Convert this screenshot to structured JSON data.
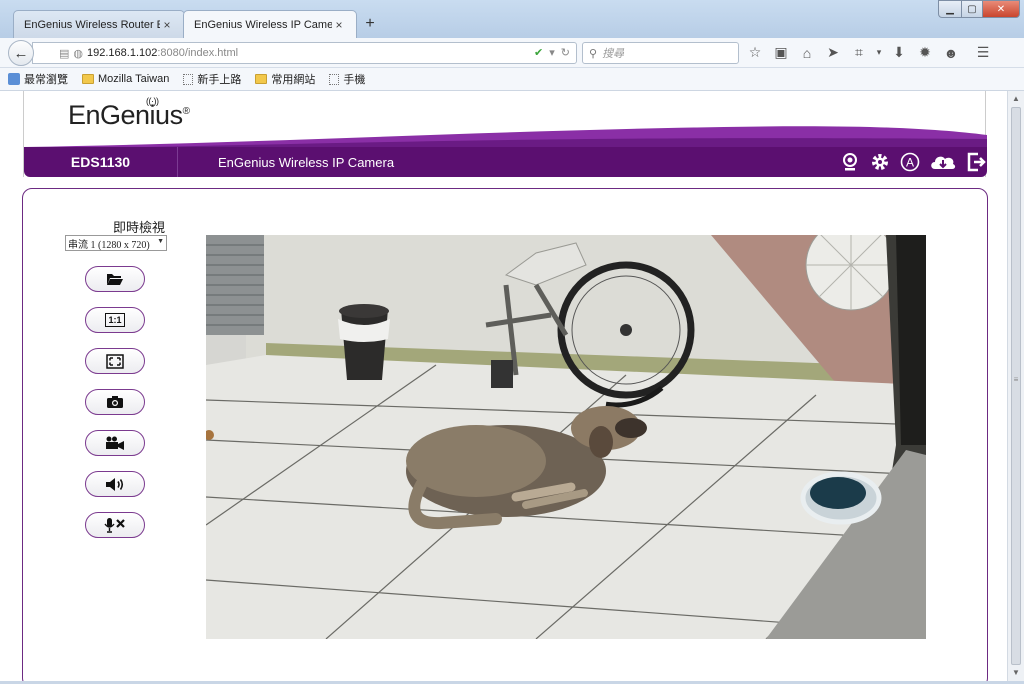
{
  "browser": {
    "tabs": [
      {
        "label": "EnGenius Wireless Router ES...",
        "close": "×",
        "active": false
      },
      {
        "label": "EnGenius Wireless IP Camera",
        "close": "×",
        "active": true
      }
    ],
    "new_tab": "+",
    "url_host": "192.168.1.102",
    "url_path": ":8080/index.html",
    "search_placeholder": "搜尋",
    "bookmarks": [
      {
        "label": "最常瀏覽",
        "icon": "star-icon"
      },
      {
        "label": "Mozilla Taiwan",
        "icon": "folder-icon"
      },
      {
        "label": "新手上路",
        "icon": "page-icon"
      },
      {
        "label": "常用網站",
        "icon": "folder-icon"
      },
      {
        "label": "手機",
        "icon": "page-icon"
      }
    ]
  },
  "header": {
    "logo_text": "EnGenius",
    "logo_mark": "®",
    "model": "EDS1130",
    "title": "EnGenius Wireless IP Camera",
    "icons": [
      "camera-view-icon",
      "gear-icon",
      "account-icon",
      "cloud-download-icon",
      "logout-icon"
    ],
    "brand_color": "#5b0f70"
  },
  "sidebar": {
    "live_view_label": "即時檢視",
    "stream_selected": "串流 1 (1280 x 720)",
    "controls": [
      {
        "name": "open-folder-button",
        "icon": "folder-open-icon"
      },
      {
        "name": "actual-size-button",
        "icon": "one-to-one-icon",
        "text": "1:1"
      },
      {
        "name": "fullscreen-button",
        "icon": "fullscreen-icon"
      },
      {
        "name": "snapshot-button",
        "icon": "camera-icon"
      },
      {
        "name": "record-button",
        "icon": "video-record-icon"
      },
      {
        "name": "speaker-button",
        "icon": "speaker-icon"
      },
      {
        "name": "mic-mute-button",
        "icon": "mic-muted-icon"
      }
    ]
  }
}
